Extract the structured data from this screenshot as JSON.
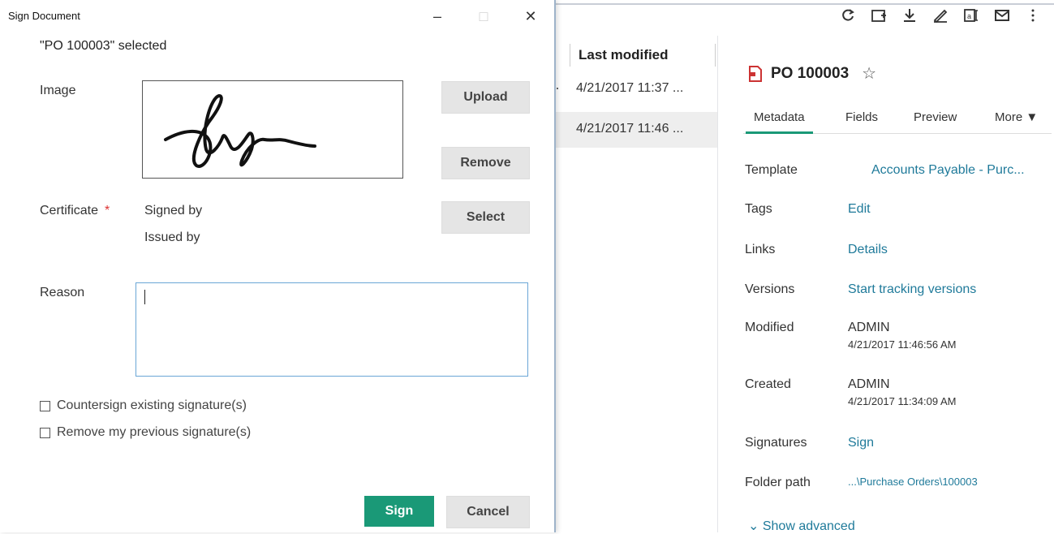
{
  "dialog": {
    "title": "Sign Document",
    "selected_text": "\"PO 100003\" selected",
    "image_label": "Image",
    "upload_label": "Upload",
    "remove_label": "Remove",
    "certificate_label": "Certificate",
    "required_mark": "*",
    "signed_by_label": "Signed by",
    "issued_by_label": "Issued by",
    "select_label": "Select",
    "reason_label": "Reason",
    "reason_value": "",
    "countersign_label": "Countersign existing signature(s)",
    "remove_previous_label": "Remove my previous signature(s)",
    "sign_label": "Sign",
    "cancel_label": "Cancel",
    "window_controls": {
      "minimize": "–",
      "maximize": "□",
      "close": "✕"
    }
  },
  "toolbar": {
    "icons": [
      "refresh-icon",
      "new-folder-icon",
      "download-icon",
      "sign-icon",
      "text-extract-icon",
      "email-icon",
      "more-vertical-icon"
    ]
  },
  "list": {
    "header": "Last modified",
    "rows": [
      "4/21/2017 11:37 ...",
      "4/21/2017 11:46 ..."
    ]
  },
  "details": {
    "doc_name": "PO 100003",
    "tabs": [
      "Metadata",
      "Fields",
      "Preview",
      "More ▼"
    ],
    "properties": {
      "template_label": "Template",
      "template_value": "Accounts Payable - Purc...",
      "tags_label": "Tags",
      "tags_value": "Edit",
      "links_label": "Links",
      "links_value": "Details",
      "versions_label": "Versions",
      "versions_value": "Start tracking versions",
      "modified_label": "Modified",
      "modified_user": "ADMIN",
      "modified_date": "4/21/2017 11:46:56 AM",
      "created_label": "Created",
      "created_user": "ADMIN",
      "created_date": "4/21/2017 11:34:09 AM",
      "signatures_label": "Signatures",
      "signatures_value": "Sign",
      "folder_label": "Folder path",
      "folder_value": "...\\Purchase Orders\\100003"
    },
    "show_advanced": "Show advanced"
  },
  "colors": {
    "accent": "#1a9977",
    "link": "#1f7a9a",
    "required": "#d33333"
  }
}
